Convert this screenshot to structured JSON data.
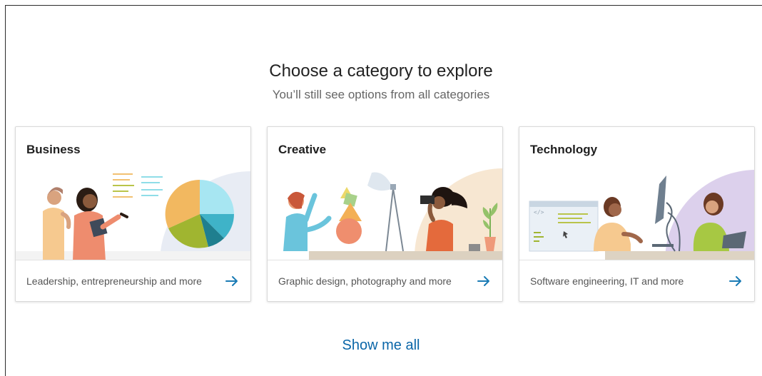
{
  "header": {
    "title": "Choose a category to explore",
    "subtitle": "You’ll still see options from all categories"
  },
  "cards": [
    {
      "title": "Business",
      "description": "Leadership, entrepreneurship and more",
      "icon": "arrow-right-icon"
    },
    {
      "title": "Creative",
      "description": "Graphic design, photography and more",
      "icon": "arrow-right-icon"
    },
    {
      "title": "Technology",
      "description": "Software engineering, IT and more",
      "icon": "arrow-right-icon"
    }
  ],
  "footer": {
    "show_all_label": "Show me all"
  },
  "colors": {
    "accent": "#0a66a8",
    "arrow": "#1a7bb5",
    "business_bg": "#e8ecf4",
    "creative_bg": "#f7e7d2",
    "technology_bg": "#dcd0ec"
  }
}
